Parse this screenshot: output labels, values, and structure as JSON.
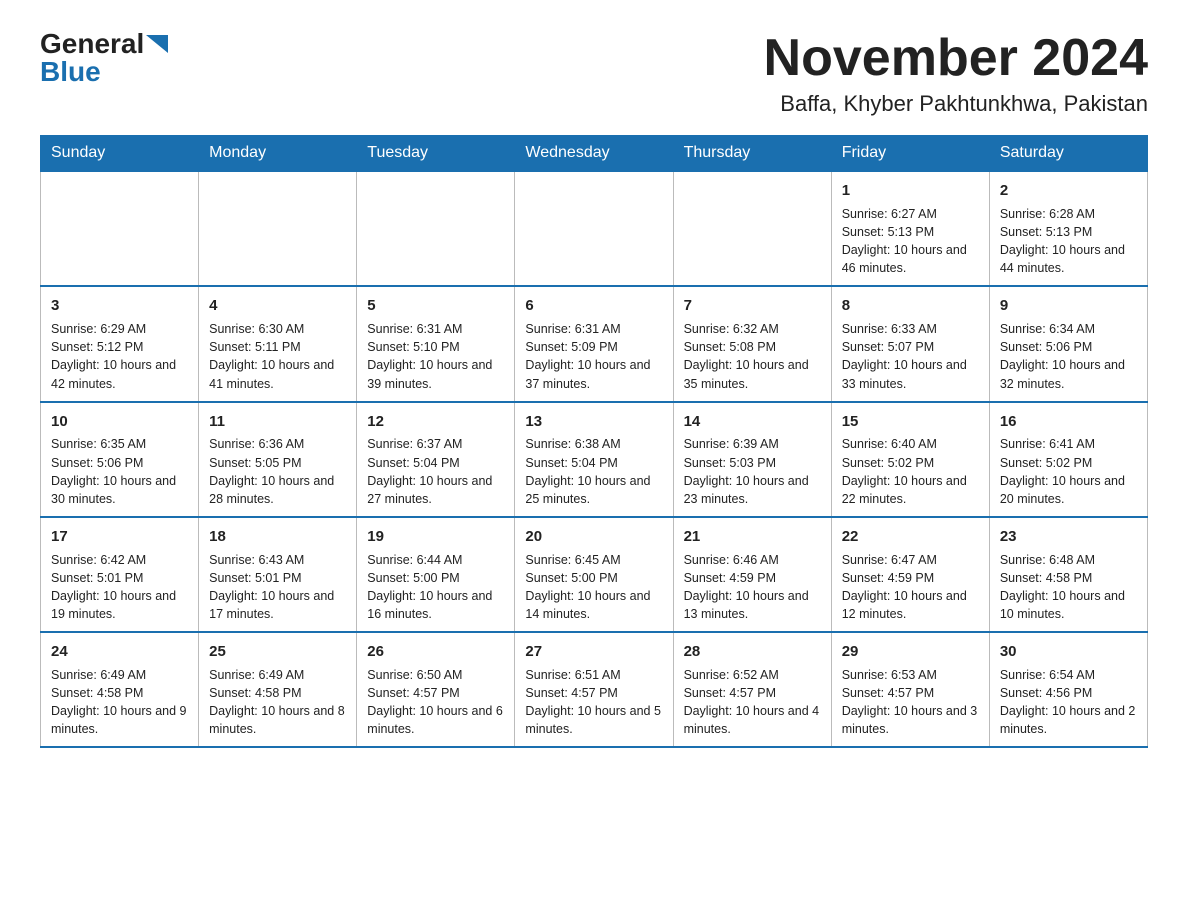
{
  "header": {
    "logo_general": "General",
    "logo_blue": "Blue",
    "month_title": "November 2024",
    "location": "Baffa, Khyber Pakhtunkhwa, Pakistan"
  },
  "days_of_week": [
    "Sunday",
    "Monday",
    "Tuesday",
    "Wednesday",
    "Thursday",
    "Friday",
    "Saturday"
  ],
  "weeks": [
    [
      {
        "day": "",
        "info": ""
      },
      {
        "day": "",
        "info": ""
      },
      {
        "day": "",
        "info": ""
      },
      {
        "day": "",
        "info": ""
      },
      {
        "day": "",
        "info": ""
      },
      {
        "day": "1",
        "info": "Sunrise: 6:27 AM\nSunset: 5:13 PM\nDaylight: 10 hours and 46 minutes."
      },
      {
        "day": "2",
        "info": "Sunrise: 6:28 AM\nSunset: 5:13 PM\nDaylight: 10 hours and 44 minutes."
      }
    ],
    [
      {
        "day": "3",
        "info": "Sunrise: 6:29 AM\nSunset: 5:12 PM\nDaylight: 10 hours and 42 minutes."
      },
      {
        "day": "4",
        "info": "Sunrise: 6:30 AM\nSunset: 5:11 PM\nDaylight: 10 hours and 41 minutes."
      },
      {
        "day": "5",
        "info": "Sunrise: 6:31 AM\nSunset: 5:10 PM\nDaylight: 10 hours and 39 minutes."
      },
      {
        "day": "6",
        "info": "Sunrise: 6:31 AM\nSunset: 5:09 PM\nDaylight: 10 hours and 37 minutes."
      },
      {
        "day": "7",
        "info": "Sunrise: 6:32 AM\nSunset: 5:08 PM\nDaylight: 10 hours and 35 minutes."
      },
      {
        "day": "8",
        "info": "Sunrise: 6:33 AM\nSunset: 5:07 PM\nDaylight: 10 hours and 33 minutes."
      },
      {
        "day": "9",
        "info": "Sunrise: 6:34 AM\nSunset: 5:06 PM\nDaylight: 10 hours and 32 minutes."
      }
    ],
    [
      {
        "day": "10",
        "info": "Sunrise: 6:35 AM\nSunset: 5:06 PM\nDaylight: 10 hours and 30 minutes."
      },
      {
        "day": "11",
        "info": "Sunrise: 6:36 AM\nSunset: 5:05 PM\nDaylight: 10 hours and 28 minutes."
      },
      {
        "day": "12",
        "info": "Sunrise: 6:37 AM\nSunset: 5:04 PM\nDaylight: 10 hours and 27 minutes."
      },
      {
        "day": "13",
        "info": "Sunrise: 6:38 AM\nSunset: 5:04 PM\nDaylight: 10 hours and 25 minutes."
      },
      {
        "day": "14",
        "info": "Sunrise: 6:39 AM\nSunset: 5:03 PM\nDaylight: 10 hours and 23 minutes."
      },
      {
        "day": "15",
        "info": "Sunrise: 6:40 AM\nSunset: 5:02 PM\nDaylight: 10 hours and 22 minutes."
      },
      {
        "day": "16",
        "info": "Sunrise: 6:41 AM\nSunset: 5:02 PM\nDaylight: 10 hours and 20 minutes."
      }
    ],
    [
      {
        "day": "17",
        "info": "Sunrise: 6:42 AM\nSunset: 5:01 PM\nDaylight: 10 hours and 19 minutes."
      },
      {
        "day": "18",
        "info": "Sunrise: 6:43 AM\nSunset: 5:01 PM\nDaylight: 10 hours and 17 minutes."
      },
      {
        "day": "19",
        "info": "Sunrise: 6:44 AM\nSunset: 5:00 PM\nDaylight: 10 hours and 16 minutes."
      },
      {
        "day": "20",
        "info": "Sunrise: 6:45 AM\nSunset: 5:00 PM\nDaylight: 10 hours and 14 minutes."
      },
      {
        "day": "21",
        "info": "Sunrise: 6:46 AM\nSunset: 4:59 PM\nDaylight: 10 hours and 13 minutes."
      },
      {
        "day": "22",
        "info": "Sunrise: 6:47 AM\nSunset: 4:59 PM\nDaylight: 10 hours and 12 minutes."
      },
      {
        "day": "23",
        "info": "Sunrise: 6:48 AM\nSunset: 4:58 PM\nDaylight: 10 hours and 10 minutes."
      }
    ],
    [
      {
        "day": "24",
        "info": "Sunrise: 6:49 AM\nSunset: 4:58 PM\nDaylight: 10 hours and 9 minutes."
      },
      {
        "day": "25",
        "info": "Sunrise: 6:49 AM\nSunset: 4:58 PM\nDaylight: 10 hours and 8 minutes."
      },
      {
        "day": "26",
        "info": "Sunrise: 6:50 AM\nSunset: 4:57 PM\nDaylight: 10 hours and 6 minutes."
      },
      {
        "day": "27",
        "info": "Sunrise: 6:51 AM\nSunset: 4:57 PM\nDaylight: 10 hours and 5 minutes."
      },
      {
        "day": "28",
        "info": "Sunrise: 6:52 AM\nSunset: 4:57 PM\nDaylight: 10 hours and 4 minutes."
      },
      {
        "day": "29",
        "info": "Sunrise: 6:53 AM\nSunset: 4:57 PM\nDaylight: 10 hours and 3 minutes."
      },
      {
        "day": "30",
        "info": "Sunrise: 6:54 AM\nSunset: 4:56 PM\nDaylight: 10 hours and 2 minutes."
      }
    ]
  ]
}
